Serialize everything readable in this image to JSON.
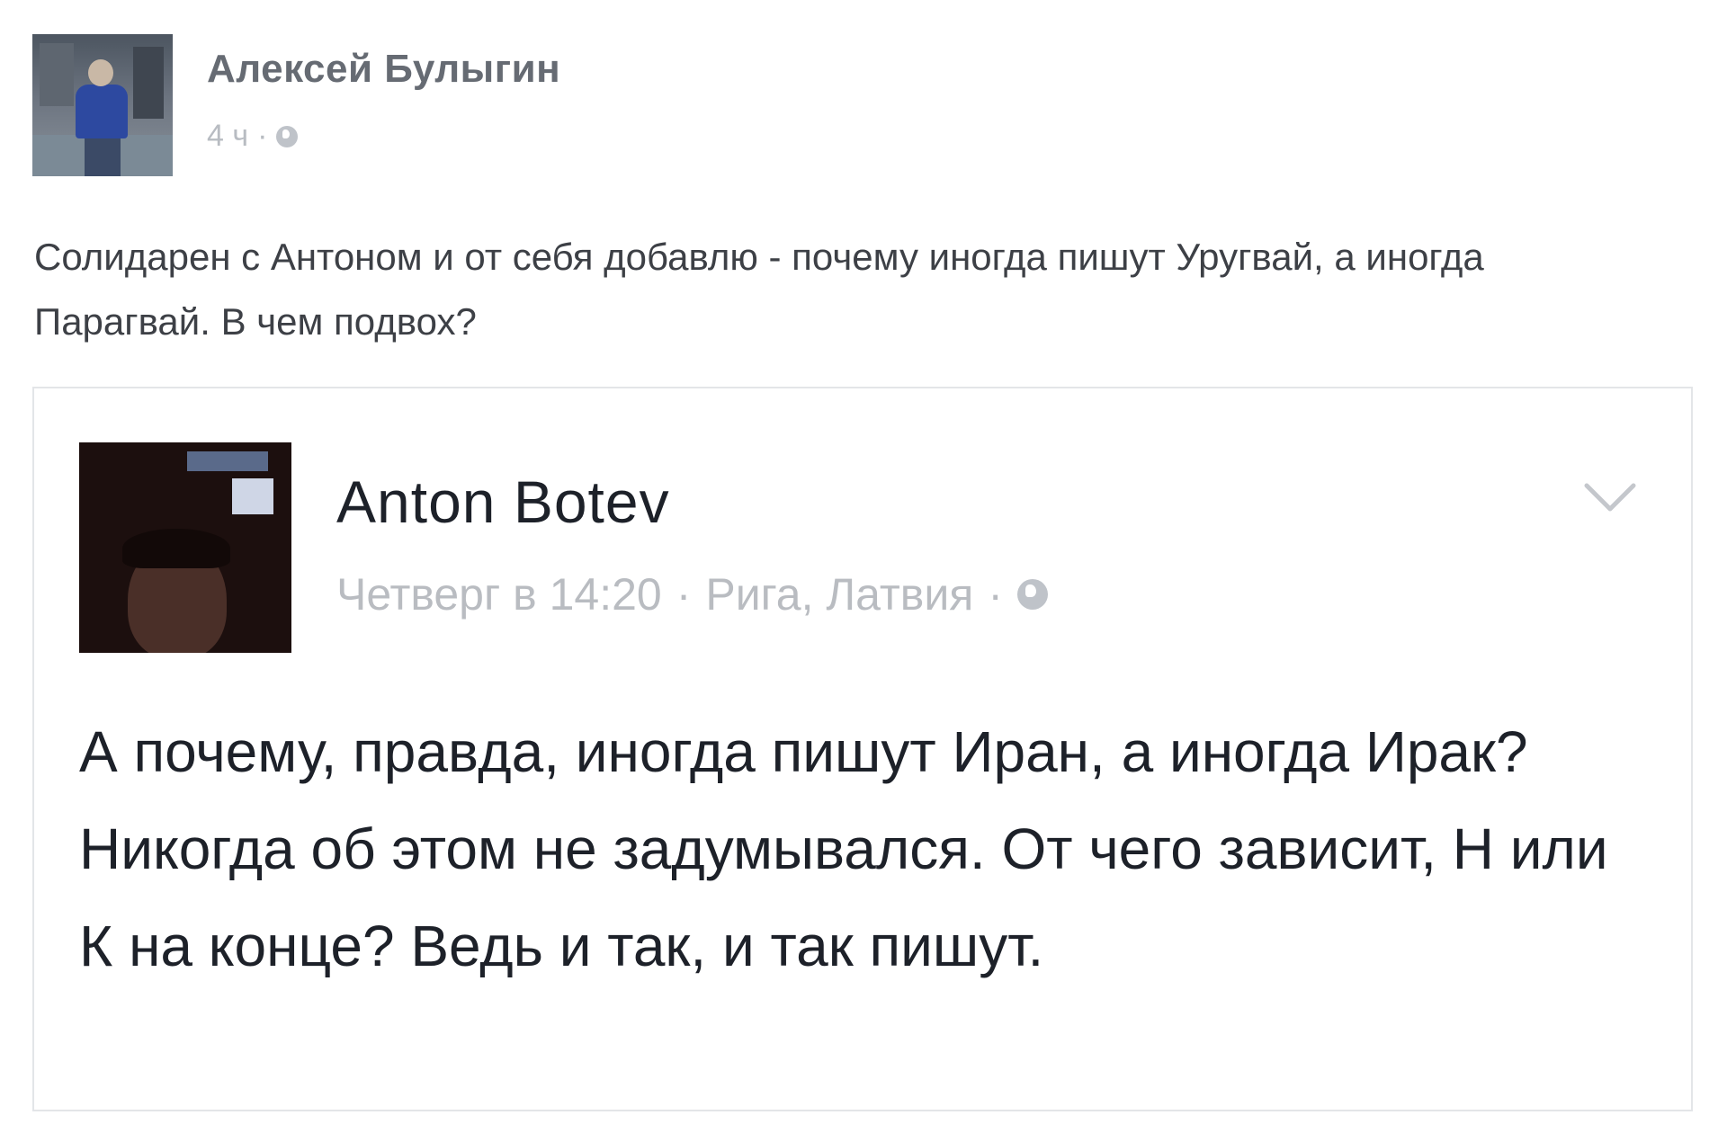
{
  "outer_post": {
    "author": "Алексей Булыгин",
    "time": "4 ч",
    "separator": "·",
    "privacy_icon": "globe-icon",
    "text": "Солидарен с Антоном и от себя добавлю - почему иногда пишут Уругвай, а иногда Парагвай. В чем подвох?"
  },
  "shared_post": {
    "author": "Anton Botev",
    "time": "Четверг в 14:20",
    "separator": "·",
    "location": "Рига, Латвия",
    "separator2": "·",
    "privacy_icon": "globe-icon",
    "menu_icon": "chevron-down-icon",
    "text": "А почему, правда, иногда пишут Иран, а иногда Ирак? Никогда об этом не задумывался. От чего зависит, Н или К на конце? Ведь и так, и так пишут."
  }
}
